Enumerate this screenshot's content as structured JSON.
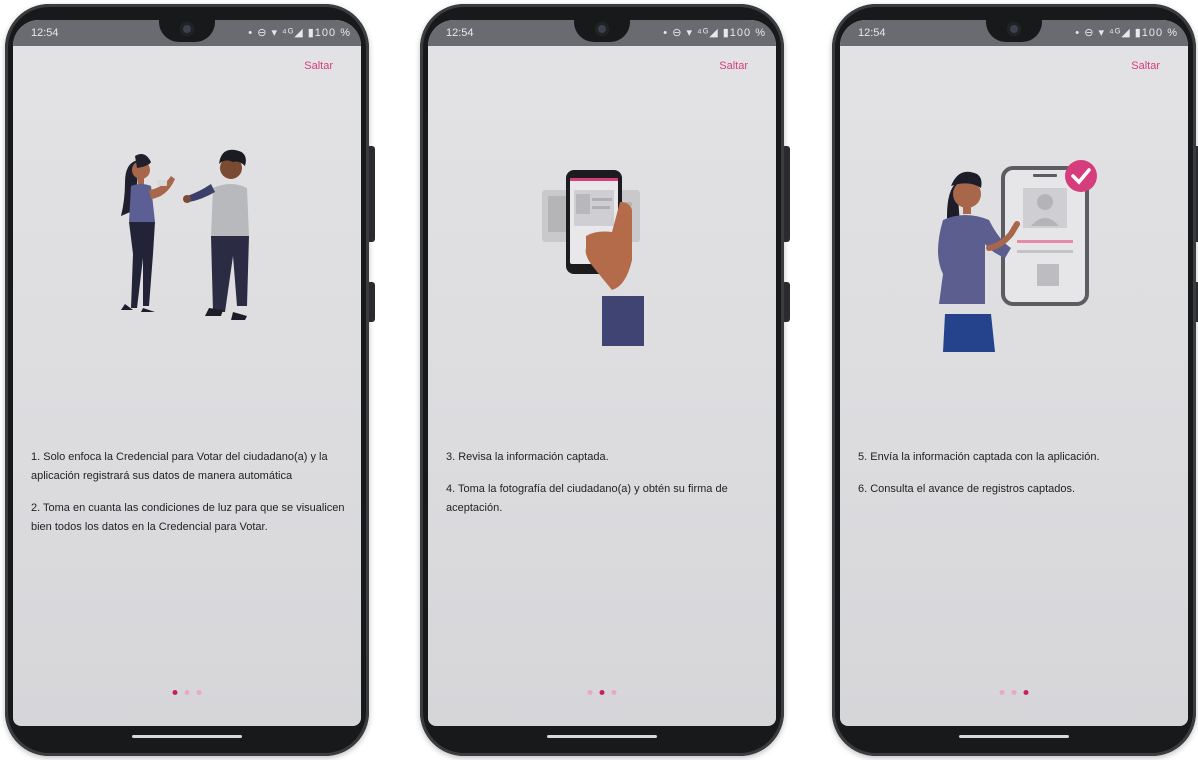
{
  "statusbar": {
    "time": "12:54",
    "icons": "• ⊖ ▾ ⁴ᴳ◢ ▮100 %"
  },
  "skip_label": "Saltar",
  "screens": [
    {
      "paragraphs": [
        "1. Solo enfoca la Credencial para Votar del ciudadano(a) y la aplicación registrará sus datos de manera automática",
        "2. Toma en cuanta las condiciones de luz para que se visualicen bien todos los datos en la Credencial para Votar."
      ],
      "active_dot": 0
    },
    {
      "paragraphs": [
        "3. Revisa la información captada.",
        "4. Toma la fotografía del ciudadano(a) y obtén su firma de aceptación."
      ],
      "active_dot": 1
    },
    {
      "paragraphs": [
        "5. Envía la información captada con la aplicación.",
        "6. Consulta el avance de registros captados."
      ],
      "active_dot": 2
    }
  ],
  "colors": {
    "accent": "#d63d7c",
    "dot_active": "#c4225f",
    "dot_inactive": "#e9a8c4"
  }
}
